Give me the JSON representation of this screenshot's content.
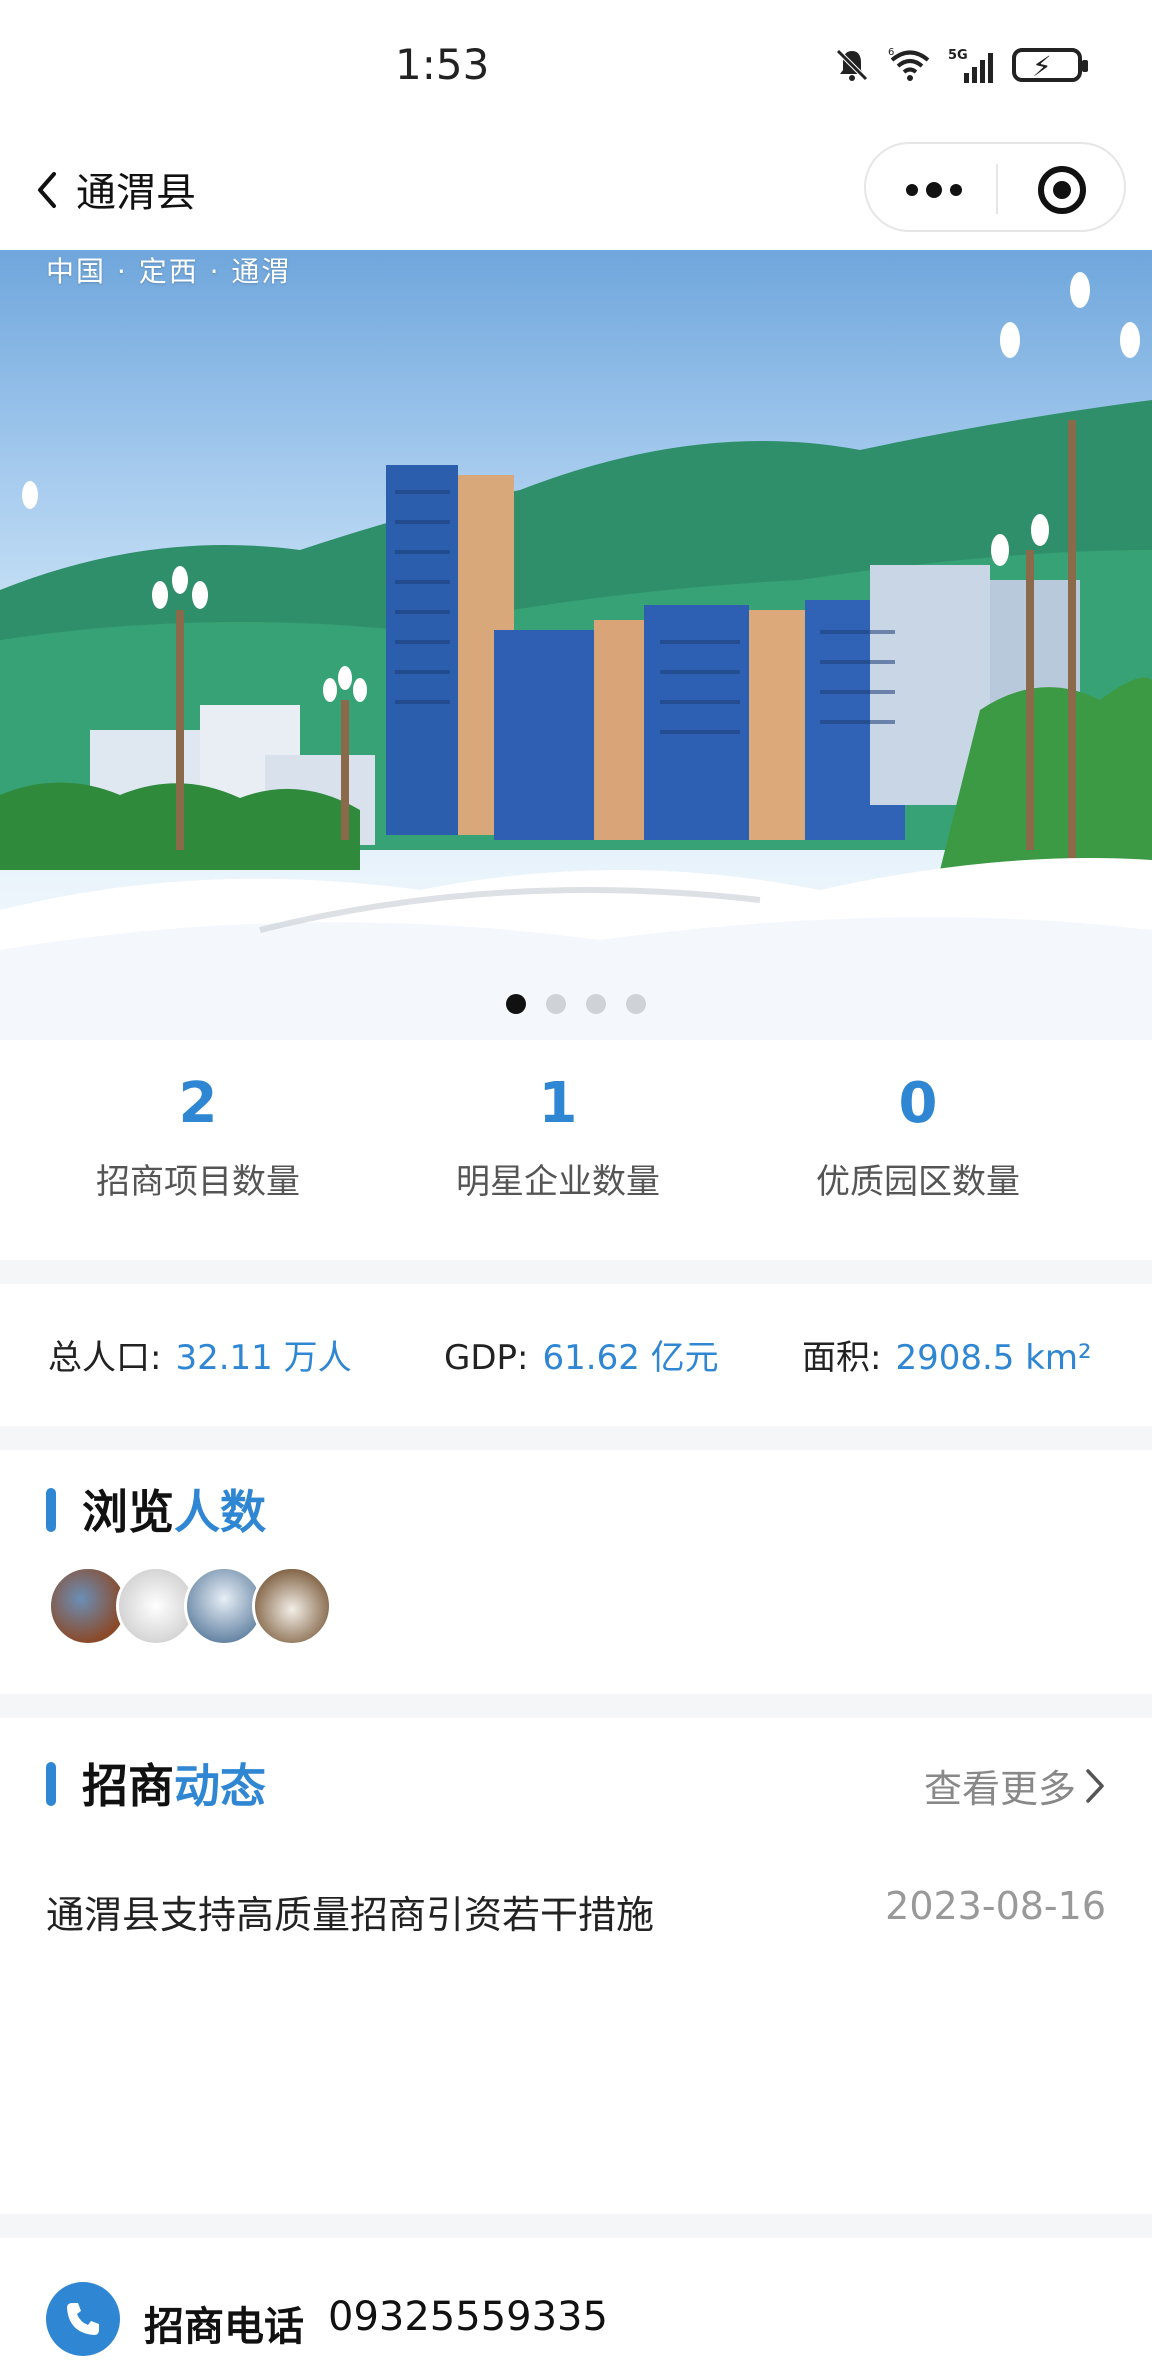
{
  "status_bar": {
    "time": "1:53",
    "icons": [
      "bell-muted-icon",
      "wifi-icon",
      "signal-5g-icon",
      "battery-charging-icon"
    ],
    "signal_label": "5G",
    "wifi_label": "6"
  },
  "nav": {
    "title": "通渭县"
  },
  "banner": {
    "tag": "中国 · 定西 · 通渭",
    "slides": 4,
    "active_slide": 0
  },
  "stats": [
    {
      "value": "2",
      "label": "招商项目数量"
    },
    {
      "value": "1",
      "label": "明星企业数量"
    },
    {
      "value": "0",
      "label": "优质园区数量"
    }
  ],
  "info": {
    "population_key": "总人口:",
    "population_value": "32.11 万人",
    "gdp_key": "GDP:",
    "gdp_value": "61.62 亿元",
    "area_key": "面积:",
    "area_value": "2908.5 km²"
  },
  "viewers": {
    "title_plain": "浏览",
    "title_accent": "人数"
  },
  "news": {
    "title_plain": "招商",
    "title_accent": "动态",
    "more_label": "查看更多",
    "items": [
      {
        "title": "通渭县支持高质量招商引资若干措施",
        "date": "2023-08-16"
      }
    ]
  },
  "footer": {
    "label": "招商电话",
    "phone": "09325559335"
  },
  "colors": {
    "accent": "#2f86d3"
  }
}
